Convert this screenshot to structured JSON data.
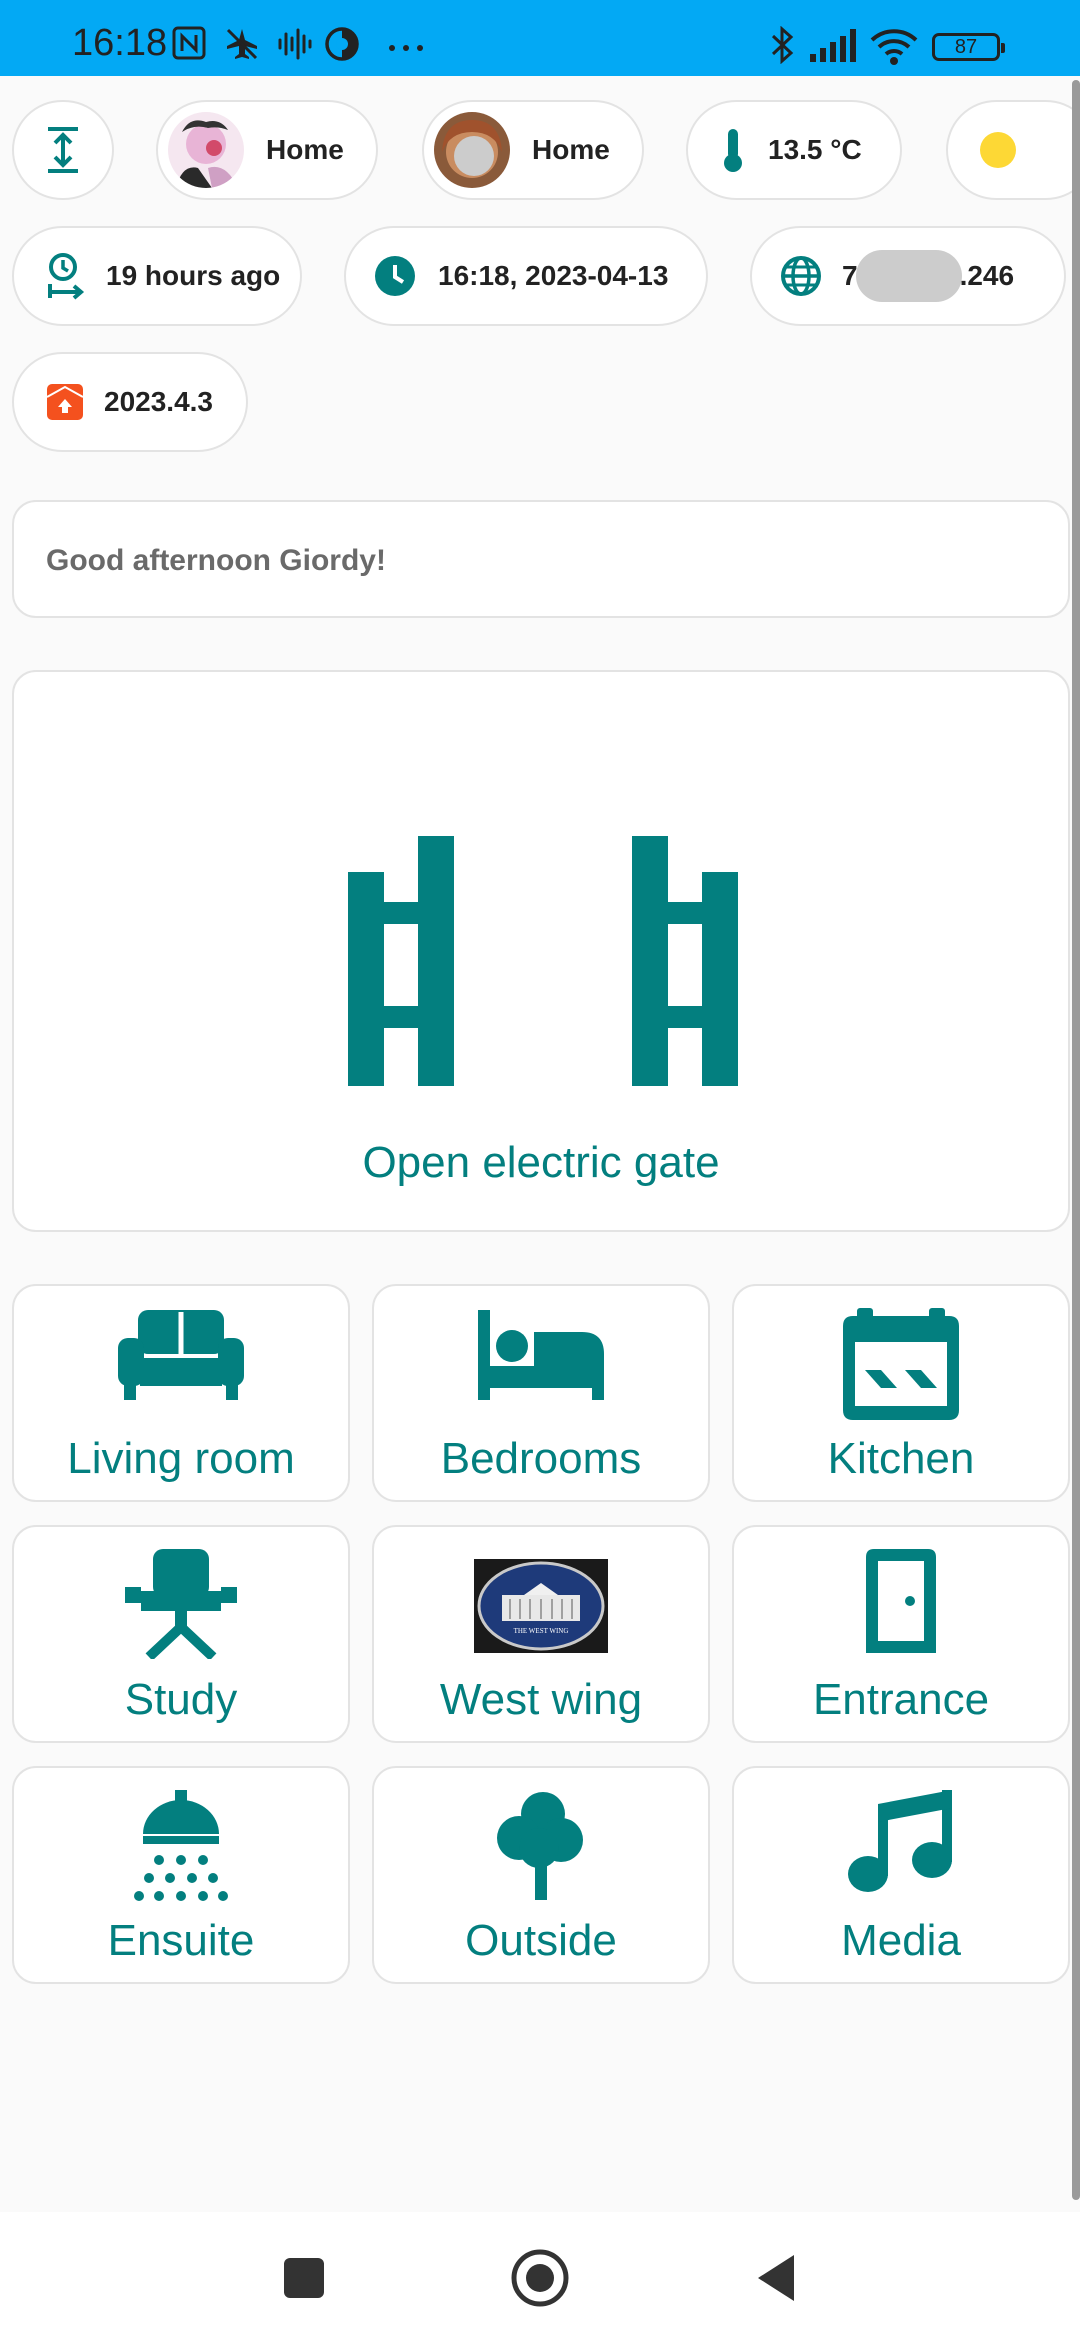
{
  "status_bar": {
    "time": "16:18",
    "battery": "87",
    "icons": [
      "nfc-icon",
      "airplane-off-icon",
      "sound-wave-icon",
      "vpn-icon",
      "more-icon",
      "bluetooth-icon",
      "signal-icon",
      "wifi-icon",
      "battery-icon"
    ]
  },
  "chips": {
    "person1": {
      "label": "Home",
      "icon": "avatar"
    },
    "person2": {
      "label": "Home",
      "icon": "avatar"
    },
    "temperature": {
      "label": "13.5 °C",
      "icon": "thermometer-icon"
    },
    "weather": {
      "icon": "sun-icon"
    },
    "last_changed": {
      "label": "19 hours ago",
      "icon": "clock-arrow-icon"
    },
    "datetime": {
      "label": "16:18, 2023-04-13",
      "icon": "clock-icon"
    },
    "ip": {
      "prefix": "7",
      "suffix": ".246",
      "icon": "globe-icon"
    },
    "version": {
      "label": "2023.4.3",
      "icon": "home-assistant-icon"
    }
  },
  "greeting": "Good afternoon Giordy!",
  "gate": {
    "label": "Open electric gate",
    "icon": "gate-icon"
  },
  "rooms": [
    {
      "label": "Living room",
      "icon": "sofa-icon"
    },
    {
      "label": "Bedrooms",
      "icon": "bed-icon"
    },
    {
      "label": "Kitchen",
      "icon": "stove-icon"
    },
    {
      "label": "Study",
      "icon": "desk-chair-icon"
    },
    {
      "label": "West wing",
      "icon": "west-wing-logo"
    },
    {
      "label": "Entrance",
      "icon": "door-icon"
    },
    {
      "label": "Ensuite",
      "icon": "shower-icon"
    },
    {
      "label": "Outside",
      "icon": "tree-icon"
    },
    {
      "label": "Media",
      "icon": "music-icon"
    }
  ],
  "west_wing_logo_text": "THE WEST WING",
  "colors": {
    "accent": "#037f7f",
    "status_bar": "#03a9f4",
    "version_badge": "#f4511e",
    "sun": "#fdd835"
  }
}
